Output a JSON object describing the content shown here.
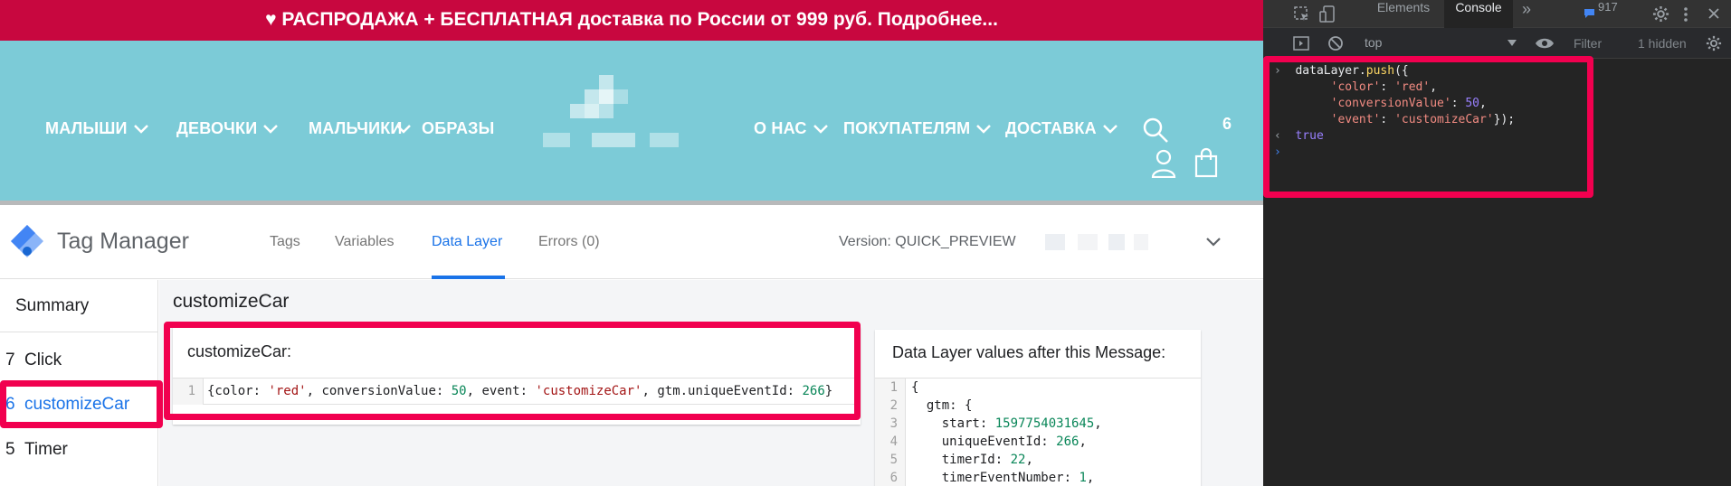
{
  "promo": {
    "text": "♥ РАСПРОДАЖА + БЕСПЛАТНАЯ доставка по России от 999 руб. Подробнее..."
  },
  "shop_nav": {
    "left": [
      "МАЛЫШИ",
      "ДЕВОЧКИ",
      "МАЛЬЧИКИ",
      "ОБРАЗЫ"
    ],
    "right": [
      "О НАС",
      "ПОКУПАТЕЛЯМ",
      "ДОСТАВКА"
    ],
    "cart_count": "6"
  },
  "gtm": {
    "title": "Tag Manager",
    "tabs": [
      "Tags",
      "Variables",
      "Data Layer",
      "Errors (0)"
    ],
    "active_tab": "Data Layer",
    "version": "Version: QUICK_PREVIEW",
    "sidebar": [
      {
        "num": "",
        "label": "Summary"
      },
      {
        "num": "7",
        "label": "Click"
      },
      {
        "num": "6",
        "label": "customizeCar"
      },
      {
        "num": "5",
        "label": "Timer"
      }
    ],
    "event_heading": "customizeCar",
    "message_card": {
      "title": "customizeCar:",
      "line_no": "1"
    },
    "datalayer_card": {
      "title": "Data Layer values after this Message:",
      "lines": [
        {
          "no": "1",
          "text": "{"
        },
        {
          "no": "2",
          "text": "  gtm: {"
        },
        {
          "no": "3",
          "key": "    start: ",
          "val": "1597754031645",
          "end": ","
        },
        {
          "no": "4",
          "key": "    uniqueEventId: ",
          "val": "266",
          "end": ","
        },
        {
          "no": "5",
          "key": "    timerId: ",
          "val": "22",
          "end": ","
        },
        {
          "no": "6",
          "key": "    timerEventNumber: ",
          "val": "1",
          "end": ","
        }
      ]
    }
  },
  "devtools": {
    "tabs": [
      "Elements",
      "Console"
    ],
    "active_tab": "Console",
    "more": "»",
    "message_count": "917",
    "context": "top",
    "filter_placeholder": "Filter",
    "hidden": "1 hidden",
    "console_result": "true"
  },
  "colors": {
    "promo_bg": "#c8073f",
    "header_bg": "#7ccbd7",
    "gtm_blue": "#1a73e8",
    "highlight": "#f1004f",
    "devtools_bg": "#242424"
  }
}
